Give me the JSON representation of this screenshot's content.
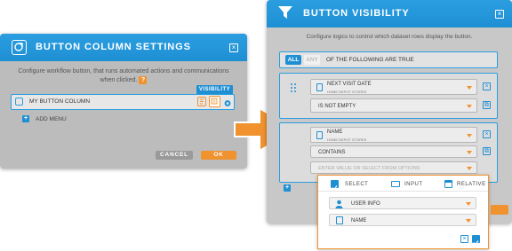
{
  "left_dialog": {
    "title": "BUTTON COLUMN SETTINGS",
    "description": "Configure workflow button, that runs automated actions and communications when clicked.",
    "help_label": "?",
    "visibility_tag": "VISIBILITY",
    "row_label": "MY BUTTON COLUMN",
    "add_menu_label": "ADD MENU",
    "cancel_label": "CANCEL",
    "ok_label": "OK"
  },
  "right_dialog": {
    "title": "BUTTON VISIBILITY",
    "description": "Configure logics to control which dataset rows display the button.",
    "logic": {
      "all_label": "ALL",
      "any_label": "ANY",
      "suffix": "OF THE FOLLOWING ARE TRUE",
      "selected": "ALL"
    },
    "conditions": [
      {
        "field_label": "NEXT VISIT DATE",
        "field_sub": "HOME DEPOT STORES",
        "operator": "IS NOT EMPTY"
      },
      {
        "field_label": "NAME",
        "field_sub": "HOME DEPOT STORES",
        "operator": "CONTAINS",
        "value_placeholder": "ENTER VALUE OR SELECT FROM OPTIONS"
      }
    ]
  },
  "popup": {
    "tabs": [
      {
        "label": "SELECT",
        "checked": true
      },
      {
        "label": "INPUT",
        "checked": false
      },
      {
        "label": "RELATIVE",
        "checked": false
      }
    ],
    "source_label": "USER INFO",
    "field_label": "NAME"
  },
  "colors": {
    "accent_blue": "#1f8fd4",
    "accent_orange": "#f0922e",
    "dialog_grey": "#c8c8c8"
  }
}
